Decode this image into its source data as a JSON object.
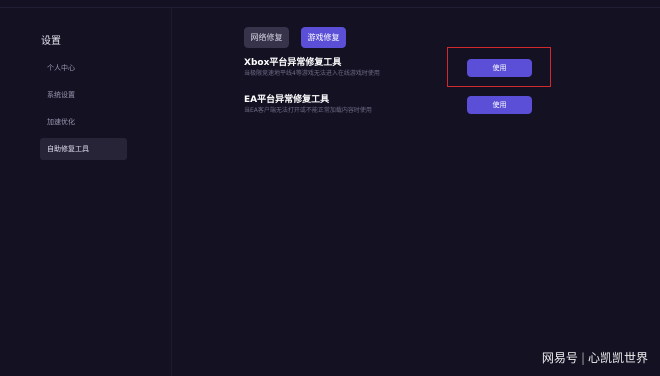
{
  "sidebar": {
    "title": "设置",
    "items": [
      {
        "label": "个人中心"
      },
      {
        "label": "系统设置"
      },
      {
        "label": "加速优化"
      },
      {
        "label": "自助修复工具"
      }
    ],
    "active_index": 3
  },
  "tabs": [
    {
      "label": "网络修复"
    },
    {
      "label": "游戏修复"
    }
  ],
  "active_tab": 1,
  "tools": [
    {
      "title": "Xbox平台异常修复工具",
      "description": "当极限竞速地平线4等游戏无法进入在线游戏时使用",
      "button_label": "使用"
    },
    {
      "title": "EA平台异常修复工具",
      "description": "当EA客户端无法打开或不能正常加载内容时使用",
      "button_label": "使用"
    }
  ],
  "watermark": {
    "source": "网易号",
    "separator": "|",
    "author": "心凯凯世界"
  },
  "colors": {
    "background": "#131122",
    "accent": "#5a4fd6",
    "highlight": "#d02a2e"
  }
}
